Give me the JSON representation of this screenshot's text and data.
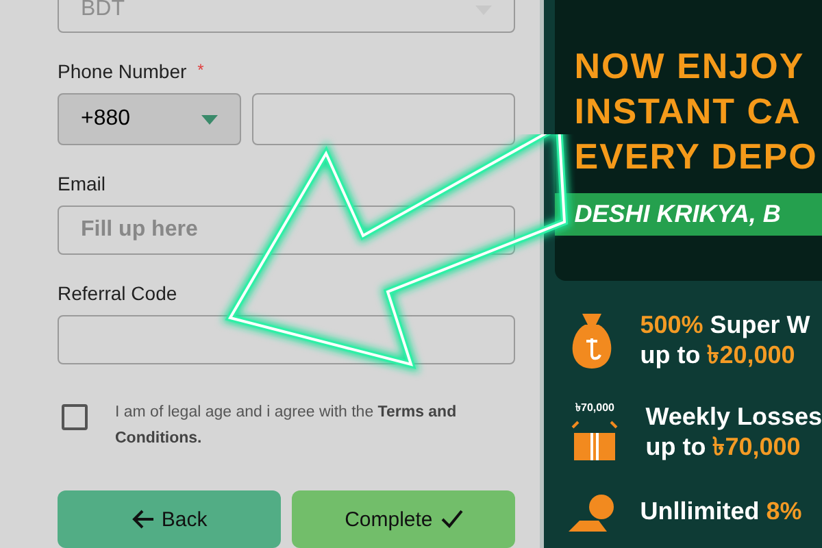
{
  "form": {
    "currency": {
      "value": "BDT",
      "disabled": true
    },
    "phone": {
      "label": "Phone Number",
      "required": "*",
      "code": "+880"
    },
    "email": {
      "label": "Email",
      "placeholder": "Fill up here"
    },
    "referral": {
      "label": "Referral Code"
    },
    "agree": {
      "text": "I am of legal age and i agree with the **Terms and Conditions.**",
      "checked": false
    },
    "buttons": [
      {
        "kind": "back",
        "label": "Back"
      },
      {
        "kind": "complete",
        "label": "Complete"
      }
    ]
  },
  "banner": {
    "headline": [
      "NOW ENJOY",
      "INSTANT CA",
      "EVERY DEPO"
    ],
    "strip": "DESHI KRIKYA, B"
  },
  "promos": [
    {
      "kind": "bag",
      "lines": [
        [
          {
            "text": "500%",
            "hl": true
          },
          {
            "text": " Super W",
            "hl": false
          }
        ],
        [
          {
            "text": "up to ",
            "hl": false
          },
          {
            "text": "৳20,000",
            "hl": true
          }
        ]
      ]
    },
    {
      "kind": "gift",
      "icon_label": "৳70,000",
      "lines": [
        [
          {
            "text": "Weekly Losses",
            "hl": false
          }
        ],
        [
          {
            "text": "up to ",
            "hl": false
          },
          {
            "text": "৳70,000",
            "hl": true
          }
        ]
      ]
    },
    {
      "kind": "coins",
      "lines": [
        [
          {
            "text": "Unllimited ",
            "hl": false
          },
          {
            "text": "8%",
            "hl": true
          }
        ]
      ]
    }
  ]
}
